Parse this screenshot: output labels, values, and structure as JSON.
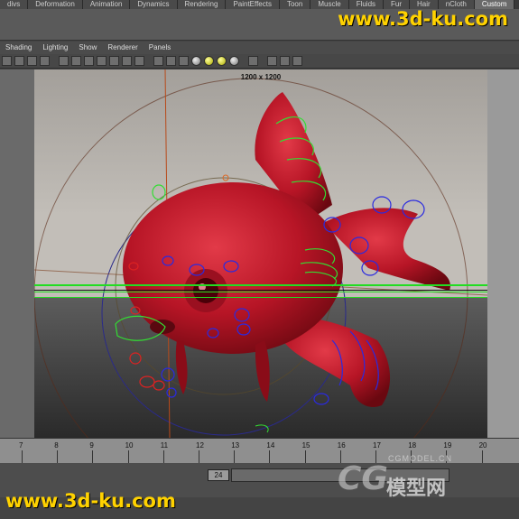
{
  "shelf_tabs": [
    "divs",
    "Deformation",
    "Animation",
    "Dynamics",
    "Rendering",
    "PaintEffects",
    "Toon",
    "Muscle",
    "Fluids",
    "Fur",
    "Hair",
    "nCloth",
    "Custom"
  ],
  "active_tab_index": 12,
  "watermark_top": "www.3d-ku.com",
  "panel_menu": [
    "Shading",
    "Lighting",
    "Show",
    "Renderer",
    "Panels"
  ],
  "viewport": {
    "resolution_label": "1200 x 1200"
  },
  "timeline": {
    "frame_labels": [
      "7",
      "8",
      "9",
      "10",
      "11",
      "12",
      "13",
      "14",
      "15",
      "16",
      "17",
      "18",
      "19",
      "20"
    ],
    "current_frame": "12"
  },
  "range": {
    "start_field": "24"
  },
  "watermark_bottom": "www.3d-ku.com",
  "logo": {
    "mark": "CG",
    "main": "模型网",
    "sub": "CGMODEL.CN"
  }
}
